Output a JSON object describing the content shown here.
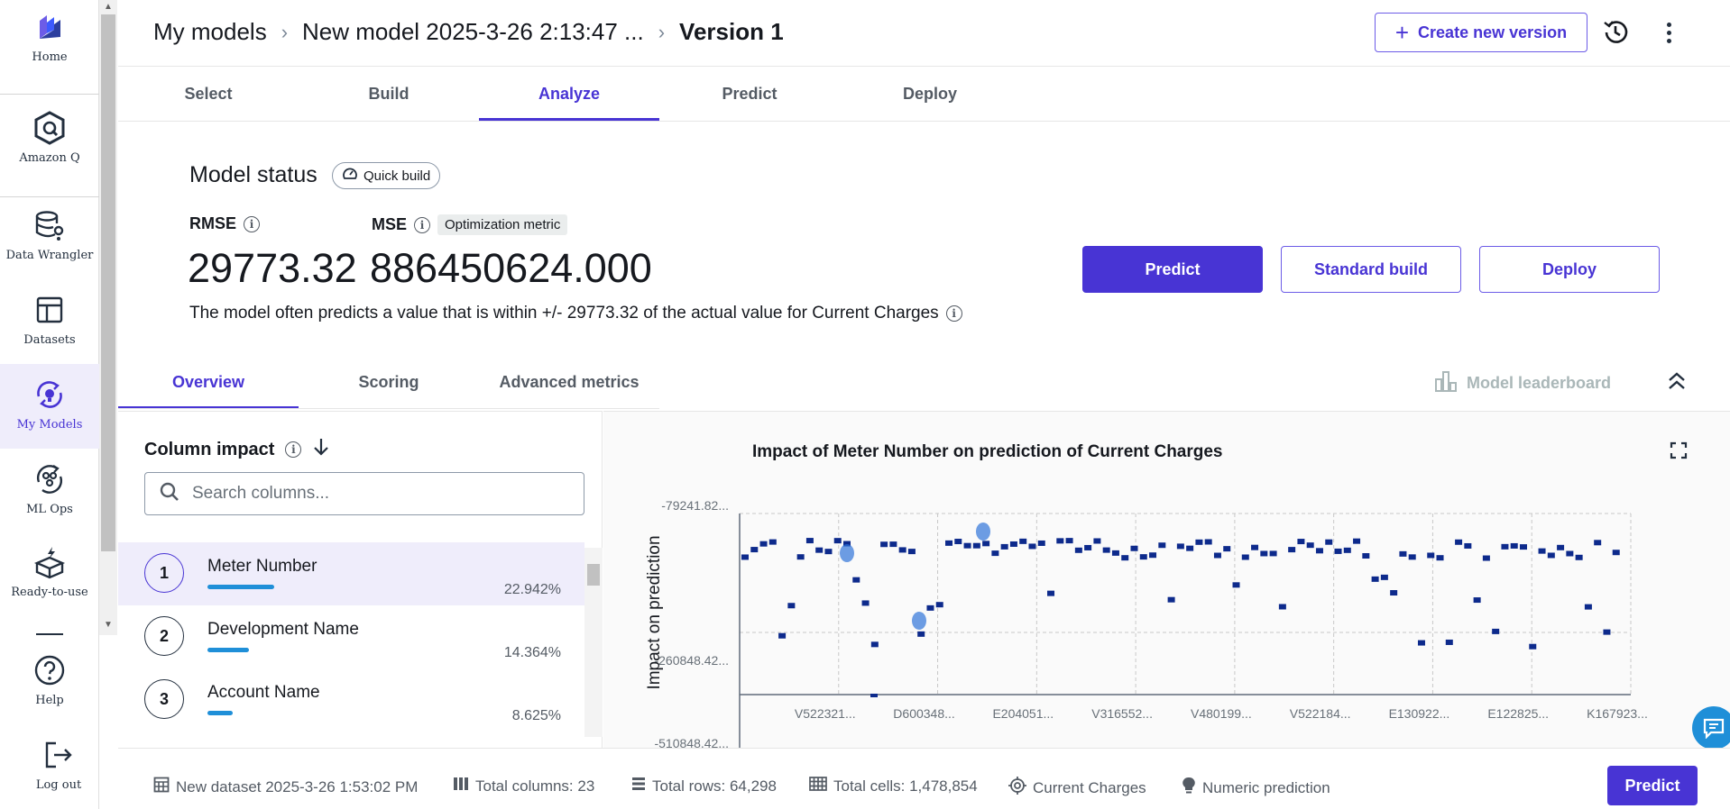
{
  "nav": {
    "items": [
      {
        "label": "Home",
        "icon": "canvas-logo-icon"
      },
      {
        "label": "Amazon Q",
        "icon": "amazon-q-icon"
      },
      {
        "label": "Data Wrangler",
        "icon": "data-wrangler-icon"
      },
      {
        "label": "Datasets",
        "icon": "datasets-icon"
      },
      {
        "label": "My Models",
        "icon": "my-models-icon",
        "active": true
      },
      {
        "label": "ML Ops",
        "icon": "ml-ops-icon"
      },
      {
        "label": "Ready-to-use",
        "icon": "ready-to-use-icon"
      },
      {
        "label": "Help",
        "icon": "help-icon"
      },
      {
        "label": "Log out",
        "icon": "logout-icon"
      }
    ]
  },
  "header": {
    "breadcrumb": [
      "My models",
      "New model 2025-3-26 2:13:47 ...",
      "Version 1"
    ],
    "create_version_label": "Create new version"
  },
  "tabs": [
    "Select",
    "Build",
    "Analyze",
    "Predict",
    "Deploy"
  ],
  "model_status": {
    "title": "Model status",
    "build_badge": "Quick build",
    "rmse_label": "RMSE",
    "rmse_value": "29773.32",
    "mse_label": "MSE",
    "mse_badge": "Optimization metric",
    "mse_value": "886450624.000",
    "description": "The model often predicts a value that is within +/- 29773.32 of the actual value for Current Charges",
    "predict_label": "Predict",
    "standard_build_label": "Standard build",
    "deploy_label": "Deploy"
  },
  "subtabs": [
    "Overview",
    "Scoring",
    "Advanced metrics"
  ],
  "leaderboard_label": "Model leaderboard",
  "column_impact": {
    "title": "Column impact",
    "search_placeholder": "Search columns...",
    "rows": [
      {
        "rank": "1",
        "name": "Meter Number",
        "percent": "22.942%",
        "value": 22.942
      },
      {
        "rank": "2",
        "name": "Development Name",
        "percent": "14.364%",
        "value": 14.364
      },
      {
        "rank": "3",
        "name": "Account Name",
        "percent": "8.625%",
        "value": 8.625
      }
    ]
  },
  "chart_data": {
    "type": "scatter",
    "title": "Impact of Meter Number on prediction of Current Charges",
    "ylabel": "Impact on prediction",
    "y_ticks": [
      "-79241.82...",
      "-260848.42...",
      "-510848.42..."
    ],
    "x_ticks": [
      "V522321...",
      "D600348...",
      "E204051...",
      "V316552...",
      "V480199...",
      "V522184...",
      "E130922...",
      "E122825...",
      "K167923..."
    ],
    "grid": true
  },
  "footer": {
    "dataset": "New dataset 2025-3-26 1:53:02 PM",
    "columns": "Total columns: 23",
    "rows": "Total rows: 64,298",
    "cells": "Total cells: 1,478,854",
    "target": "Current Charges",
    "problem_type": "Numeric prediction",
    "predict_label": "Predict"
  }
}
